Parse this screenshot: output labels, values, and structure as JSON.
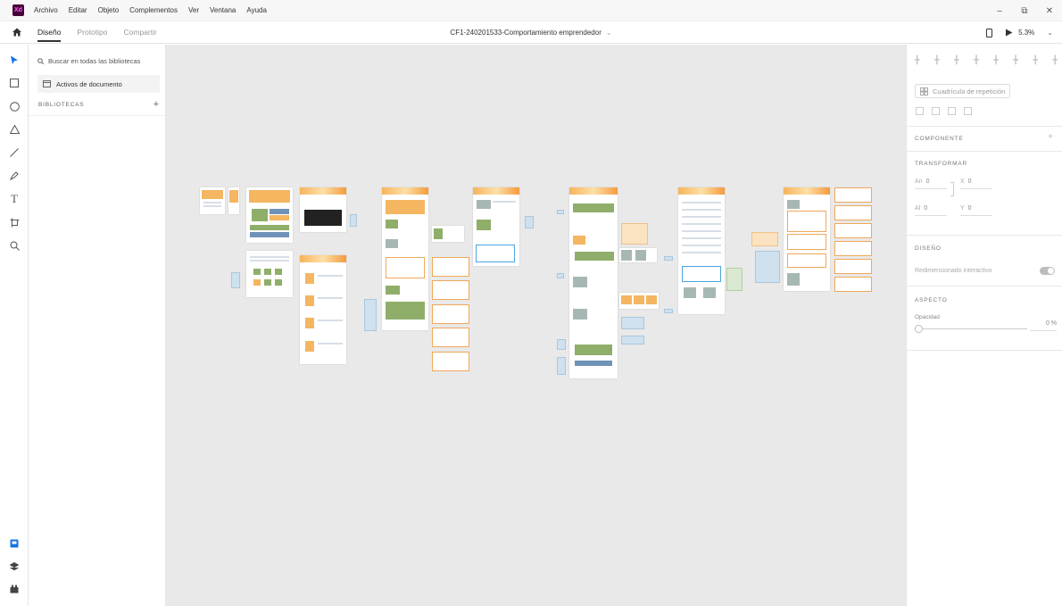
{
  "app": {
    "logo": "Xd",
    "brand_color": "#470137"
  },
  "menu": [
    "Archivo",
    "Editar",
    "Objeto",
    "Complementos",
    "Ver",
    "Ventana",
    "Ayuda"
  ],
  "window_controls": [
    "minimize-icon",
    "restore-icon",
    "close-icon"
  ],
  "tabs": [
    {
      "label": "Diseño",
      "active": true
    },
    {
      "label": "Prototipo",
      "active": false
    },
    {
      "label": "Compartir",
      "active": false
    }
  ],
  "document": {
    "title": "CF1-240201533-Comportamiento emprendedor"
  },
  "toolbar_right": {
    "zoom": "5.3%"
  },
  "tools": [
    "select-icon",
    "rectangle-icon",
    "ellipse-icon",
    "polygon-icon",
    "line-icon",
    "pen-icon",
    "text-icon",
    "artboard-icon",
    "zoom-icon"
  ],
  "bottom_tools": [
    "assets-icon",
    "layers-icon",
    "plugins-icon"
  ],
  "libraries": {
    "search_placeholder": "Buscar en todas las bibliotecas",
    "document_assets": "Activos de documento",
    "header": "BIBLIOTECAS",
    "add": "+"
  },
  "properties": {
    "repeat_grid": "Cuadrícula de repetición",
    "component_header": "COMPONENTE",
    "component_add": "+",
    "transform_header": "TRANSFORMAR",
    "width_label": "An",
    "width_value": "0",
    "x_label": "X",
    "x_value": "0",
    "height_label": "Al",
    "height_value": "0",
    "y_label": "Y",
    "y_value": "0",
    "design_header": "DISEÑO",
    "responsive_resize": "Redimensionado interactivo",
    "appearance_header": "ASPECTO",
    "opacity_label": "Opacidad",
    "opacity_value": "0 %"
  }
}
